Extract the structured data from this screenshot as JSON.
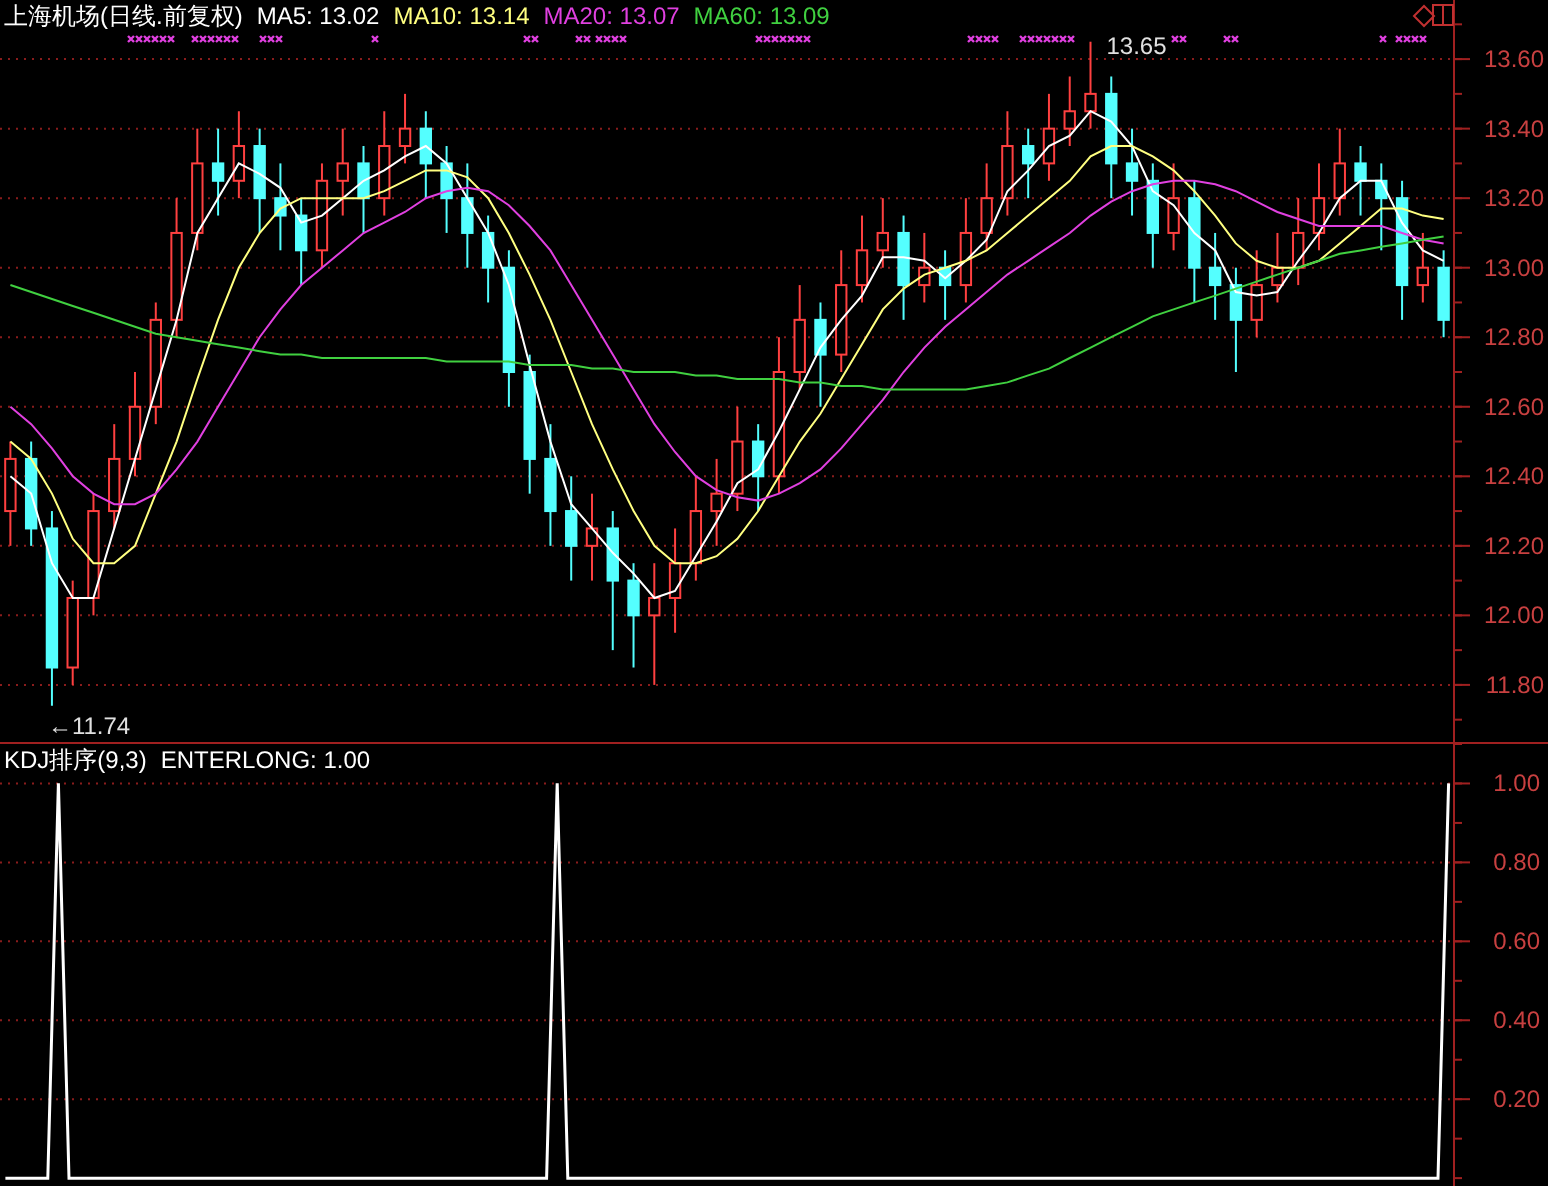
{
  "price_panel": {
    "title": "上海机场(日线.前复权)",
    "readings": [
      ": 13.02",
      ": 13.14",
      ": 13.07",
      ": 13.09"
    ],
    "chart_data": {
      "type": "candlestick",
      "grid": true,
      "categories": [
        null,
        null,
        null,
        null,
        null,
        null,
        null,
        null,
        null,
        null,
        null,
        null,
        null,
        null,
        null,
        null,
        null,
        null,
        null,
        null,
        null,
        null,
        null,
        null,
        null,
        null,
        null,
        null,
        null,
        null,
        null,
        null,
        null,
        null,
        null,
        null,
        null,
        null,
        null,
        null,
        null,
        null,
        null,
        null,
        null,
        null,
        null,
        null,
        null,
        null,
        null,
        null,
        null,
        null,
        null,
        null,
        null,
        null,
        null,
        null,
        null,
        null,
        null,
        null,
        null,
        null,
        null,
        null,
        null,
        null
      ],
      "ylim": [
        11.63,
        13.77
      ],
      "ohlc": [
        [
          12.3,
          12.5,
          12.2,
          12.45
        ],
        [
          12.45,
          12.5,
          12.2,
          12.25
        ],
        [
          12.25,
          12.3,
          11.74,
          11.85
        ],
        [
          11.85,
          12.1,
          11.8,
          12.05
        ],
        [
          12.05,
          12.35,
          12.0,
          12.3
        ],
        [
          12.3,
          12.55,
          12.25,
          12.45
        ],
        [
          12.45,
          12.7,
          12.4,
          12.6
        ],
        [
          12.6,
          12.9,
          12.55,
          12.85
        ],
        [
          12.85,
          13.2,
          12.8,
          13.1
        ],
        [
          13.1,
          13.4,
          13.05,
          13.3
        ],
        [
          13.3,
          13.4,
          13.15,
          13.25
        ],
        [
          13.25,
          13.45,
          13.2,
          13.35
        ],
        [
          13.35,
          13.4,
          13.1,
          13.2
        ],
        [
          13.2,
          13.3,
          13.05,
          13.15
        ],
        [
          13.15,
          13.2,
          12.95,
          13.05
        ],
        [
          13.05,
          13.3,
          13.0,
          13.25
        ],
        [
          13.25,
          13.4,
          13.15,
          13.3
        ],
        [
          13.3,
          13.35,
          13.1,
          13.2
        ],
        [
          13.2,
          13.45,
          13.15,
          13.35
        ],
        [
          13.35,
          13.5,
          13.3,
          13.4
        ],
        [
          13.4,
          13.45,
          13.2,
          13.3
        ],
        [
          13.3,
          13.35,
          13.1,
          13.2
        ],
        [
          13.2,
          13.3,
          13.0,
          13.1
        ],
        [
          13.1,
          13.15,
          12.9,
          13.0
        ],
        [
          13.0,
          13.05,
          12.6,
          12.7
        ],
        [
          12.7,
          12.75,
          12.35,
          12.45
        ],
        [
          12.45,
          12.55,
          12.2,
          12.3
        ],
        [
          12.3,
          12.4,
          12.1,
          12.2
        ],
        [
          12.2,
          12.35,
          12.1,
          12.25
        ],
        [
          12.25,
          12.3,
          11.9,
          12.1
        ],
        [
          12.1,
          12.15,
          11.85,
          12.0
        ],
        [
          12.0,
          12.15,
          11.8,
          12.05
        ],
        [
          12.05,
          12.25,
          11.95,
          12.15
        ],
        [
          12.15,
          12.4,
          12.1,
          12.3
        ],
        [
          12.3,
          12.45,
          12.2,
          12.35
        ],
        [
          12.35,
          12.6,
          12.3,
          12.5
        ],
        [
          12.5,
          12.55,
          12.3,
          12.4
        ],
        [
          12.4,
          12.8,
          12.35,
          12.7
        ],
        [
          12.7,
          12.95,
          12.65,
          12.85
        ],
        [
          12.85,
          12.9,
          12.6,
          12.75
        ],
        [
          12.75,
          13.05,
          12.7,
          12.95
        ],
        [
          12.95,
          13.15,
          12.9,
          13.05
        ],
        [
          13.05,
          13.2,
          13.0,
          13.1
        ],
        [
          13.1,
          13.15,
          12.85,
          12.95
        ],
        [
          12.95,
          13.1,
          12.9,
          13.0
        ],
        [
          13.0,
          13.05,
          12.85,
          12.95
        ],
        [
          12.95,
          13.2,
          12.9,
          13.1
        ],
        [
          13.1,
          13.3,
          13.05,
          13.2
        ],
        [
          13.2,
          13.45,
          13.15,
          13.35
        ],
        [
          13.35,
          13.4,
          13.2,
          13.3
        ],
        [
          13.3,
          13.5,
          13.25,
          13.4
        ],
        [
          13.4,
          13.55,
          13.35,
          13.45
        ],
        [
          13.45,
          13.65,
          13.4,
          13.5
        ],
        [
          13.5,
          13.55,
          13.2,
          13.3
        ],
        [
          13.3,
          13.4,
          13.15,
          13.25
        ],
        [
          13.25,
          13.3,
          13.0,
          13.1
        ],
        [
          13.1,
          13.3,
          13.05,
          13.2
        ],
        [
          13.2,
          13.25,
          12.9,
          13.0
        ],
        [
          13.0,
          13.1,
          12.85,
          12.95
        ],
        [
          12.95,
          13.0,
          12.7,
          12.85
        ],
        [
          12.85,
          13.05,
          12.8,
          12.95
        ],
        [
          12.95,
          13.1,
          12.9,
          13.0
        ],
        [
          13.0,
          13.2,
          12.95,
          13.1
        ],
        [
          13.1,
          13.3,
          13.05,
          13.2
        ],
        [
          13.2,
          13.4,
          13.15,
          13.3
        ],
        [
          13.3,
          13.35,
          13.15,
          13.25
        ],
        [
          13.25,
          13.3,
          13.05,
          13.2
        ],
        [
          13.2,
          13.25,
          12.85,
          12.95
        ],
        [
          12.95,
          13.1,
          12.9,
          13.0
        ],
        [
          13.0,
          13.05,
          12.8,
          12.85
        ]
      ],
      "yticks": [
        {
          "value": 13.6,
          "label": "13.60"
        },
        {
          "value": 13.4,
          "label": "13.40"
        },
        {
          "value": 13.2,
          "label": "13.20"
        },
        {
          "value": 13.0,
          "label": "13.00"
        },
        {
          "value": 12.8,
          "label": "12.80"
        },
        {
          "value": 12.6,
          "label": "12.60"
        },
        {
          "value": 12.4,
          "label": "12.40"
        },
        {
          "value": 12.2,
          "label": "12.20"
        },
        {
          "value": 12.0,
          "label": "12.00"
        },
        {
          "value": 11.8,
          "label": "11.80"
        }
      ],
      "annotations": [
        "13.65",
        "←11.74"
      ]
    },
    "moving_averages": {
      "chart_data": {
        "type": "line",
        "categories": [
          null,
          null,
          null,
          null,
          null,
          null,
          null,
          null,
          null,
          null,
          null,
          null,
          null,
          null,
          null,
          null,
          null,
          null,
          null,
          null,
          null,
          null,
          null,
          null,
          null,
          null,
          null,
          null,
          null,
          null,
          null,
          null,
          null,
          null,
          null,
          null,
          null,
          null,
          null,
          null,
          null,
          null,
          null,
          null,
          null,
          null,
          null,
          null,
          null,
          null,
          null,
          null,
          null,
          null,
          null,
          null,
          null,
          null,
          null,
          null,
          null,
          null,
          null,
          null,
          null,
          null,
          null,
          null,
          null,
          null
        ],
        "ylim": [
          11.63,
          13.77
        ],
        "series": [
          {
            "name": "MA5",
            "color": "#ffffff",
            "values": [
              12.4,
              12.35,
              12.15,
              12.05,
              12.05,
              12.25,
              12.45,
              12.65,
              12.85,
              13.1,
              13.2,
              13.3,
              13.27,
              13.23,
              13.13,
              13.15,
              13.2,
              13.25,
              13.28,
              13.32,
              13.35,
              13.3,
              13.2,
              13.1,
              12.95,
              12.72,
              12.5,
              12.32,
              12.25,
              12.18,
              12.12,
              12.05,
              12.07,
              12.17,
              12.27,
              12.38,
              12.42,
              12.53,
              12.65,
              12.77,
              12.85,
              12.92,
              13.03,
              13.03,
              13.02,
              12.97,
              13.02,
              13.08,
              13.22,
              13.28,
              13.35,
              13.38,
              13.45,
              13.42,
              13.35,
              13.22,
              13.18,
              13.1,
              13.05,
              12.93,
              12.92,
              12.93,
              13.02,
              13.1,
              13.2,
              13.25,
              13.25,
              13.13,
              13.05,
              13.02
            ]
          },
          {
            "name": "MA10",
            "color": "#ffff80",
            "values": [
              12.5,
              12.45,
              12.35,
              12.22,
              12.15,
              12.15,
              12.2,
              12.35,
              12.5,
              12.68,
              12.85,
              13.0,
              13.1,
              13.17,
              13.2,
              13.2,
              13.2,
              13.2,
              13.22,
              13.25,
              13.28,
              13.28,
              13.26,
              13.2,
              13.1,
              12.98,
              12.85,
              12.7,
              12.55,
              12.42,
              12.3,
              12.2,
              12.15,
              12.15,
              12.17,
              12.22,
              12.3,
              12.4,
              12.5,
              12.58,
              12.68,
              12.78,
              12.88,
              12.94,
              12.98,
              13.0,
              13.02,
              13.05,
              13.1,
              13.15,
              13.2,
              13.25,
              13.32,
              13.35,
              13.35,
              13.32,
              13.28,
              13.22,
              13.15,
              13.07,
              13.02,
              13.0,
              13.0,
              13.02,
              13.07,
              13.12,
              13.17,
              13.17,
              13.15,
              13.14
            ]
          },
          {
            "name": "MA20",
            "color": "#e040e0",
            "values": [
              12.6,
              12.55,
              12.48,
              12.4,
              12.35,
              12.32,
              12.32,
              12.35,
              12.42,
              12.5,
              12.6,
              12.7,
              12.8,
              12.88,
              12.95,
              13.0,
              13.05,
              13.1,
              13.13,
              13.16,
              13.2,
              13.22,
              13.23,
              13.22,
              13.18,
              13.12,
              13.05,
              12.95,
              12.85,
              12.75,
              12.65,
              12.55,
              12.47,
              12.4,
              12.36,
              12.34,
              12.33,
              12.35,
              12.38,
              12.42,
              12.48,
              12.55,
              12.62,
              12.7,
              12.77,
              12.83,
              12.88,
              12.93,
              12.98,
              13.02,
              13.06,
              13.1,
              13.15,
              13.19,
              13.22,
              13.24,
              13.25,
              13.25,
              13.24,
              13.22,
              13.19,
              13.16,
              13.14,
              13.12,
              13.12,
              13.12,
              13.12,
              13.1,
              13.08,
              13.07
            ]
          },
          {
            "name": "MA60",
            "color": "#40d040",
            "values": [
              12.95,
              12.93,
              12.91,
              12.89,
              12.87,
              12.85,
              12.83,
              12.81,
              12.8,
              12.79,
              12.78,
              12.77,
              12.76,
              12.75,
              12.75,
              12.74,
              12.74,
              12.74,
              12.74,
              12.74,
              12.74,
              12.73,
              12.73,
              12.73,
              12.73,
              12.72,
              12.72,
              12.72,
              12.71,
              12.71,
              12.7,
              12.7,
              12.7,
              12.69,
              12.69,
              12.68,
              12.68,
              12.68,
              12.67,
              12.67,
              12.66,
              12.66,
              12.65,
              12.65,
              12.65,
              12.65,
              12.65,
              12.66,
              12.67,
              12.69,
              12.71,
              12.74,
              12.77,
              12.8,
              12.83,
              12.86,
              12.88,
              12.9,
              12.92,
              12.94,
              12.96,
              12.98,
              13.0,
              13.02,
              13.04,
              13.05,
              13.06,
              13.07,
              13.08,
              13.09
            ]
          }
        ]
      }
    }
  },
  "indicator_panel": {
    "title": "KDJ排序(9,3)",
    "readings": [
      ": 1.00"
    ],
    "chart_data": {
      "type": "line",
      "grid": true,
      "categories": [
        null,
        null,
        null,
        null,
        null,
        null,
        null,
        null,
        null,
        null,
        null,
        null,
        null,
        null,
        null,
        null,
        null,
        null,
        null,
        null,
        null,
        null,
        null,
        null,
        null,
        null,
        null,
        null,
        null,
        null,
        null,
        null,
        null,
        null,
        null,
        null,
        null,
        null,
        null,
        null,
        null,
        null,
        null,
        null,
        null,
        null,
        null,
        null,
        null,
        null,
        null,
        null,
        null,
        null,
        null,
        null,
        null,
        null,
        null,
        null,
        null,
        null,
        null,
        null,
        null,
        null,
        null,
        null,
        null,
        null,
        null,
        null,
        null,
        null,
        null,
        null,
        null,
        null,
        null,
        null,
        null,
        null,
        null,
        null,
        null,
        null,
        null,
        null,
        null,
        null,
        null,
        null,
        null,
        null,
        null,
        null,
        null,
        null,
        null,
        null,
        null,
        null,
        null,
        null,
        null,
        null,
        null,
        null,
        null,
        null,
        null,
        null,
        null,
        null,
        null,
        null,
        null,
        null,
        null,
        null,
        null,
        null,
        null,
        null,
        null,
        null,
        null,
        null,
        null,
        null,
        null,
        null,
        null,
        null,
        null,
        null,
        null
      ],
      "ylim": [
        -0.02,
        1.1
      ],
      "series": [
        {
          "name": "ENTERLONG",
          "color": "#ffffff",
          "values": [
            0,
            0,
            0,
            0,
            0,
            1,
            0,
            0,
            0,
            0,
            0,
            0,
            0,
            0,
            0,
            0,
            0,
            0,
            0,
            0,
            0,
            0,
            0,
            0,
            0,
            0,
            0,
            0,
            0,
            0,
            0,
            0,
            0,
            0,
            0,
            0,
            0,
            0,
            0,
            0,
            0,
            0,
            0,
            0,
            0,
            0,
            0,
            0,
            0,
            0,
            0,
            0,
            1,
            0,
            0,
            0,
            0,
            0,
            0,
            0,
            0,
            0,
            0,
            0,
            0,
            0,
            0,
            0,
            0,
            0,
            0,
            0,
            0,
            0,
            0,
            0,
            0,
            0,
            0,
            0,
            0,
            0,
            0,
            0,
            0,
            0,
            0,
            0,
            0,
            0,
            0,
            0,
            0,
            0,
            0,
            0,
            0,
            0,
            0,
            0,
            0,
            0,
            0,
            0,
            0,
            0,
            0,
            0,
            0,
            0,
            0,
            0,
            0,
            0,
            0,
            0,
            0,
            0,
            0,
            0,
            0,
            0,
            0,
            0,
            0,
            0,
            0,
            0,
            0,
            0,
            0,
            0,
            0,
            0,
            0,
            0,
            1
          ]
        }
      ],
      "yticks": [
        {
          "value": 1.0,
          "label": "1.00"
        },
        {
          "value": 0.8,
          "label": "0.80"
        },
        {
          "value": 0.6,
          "label": "0.60"
        },
        {
          "value": 0.4,
          "label": "0.40"
        },
        {
          "value": 0.2,
          "label": "0.20"
        }
      ]
    }
  }
}
